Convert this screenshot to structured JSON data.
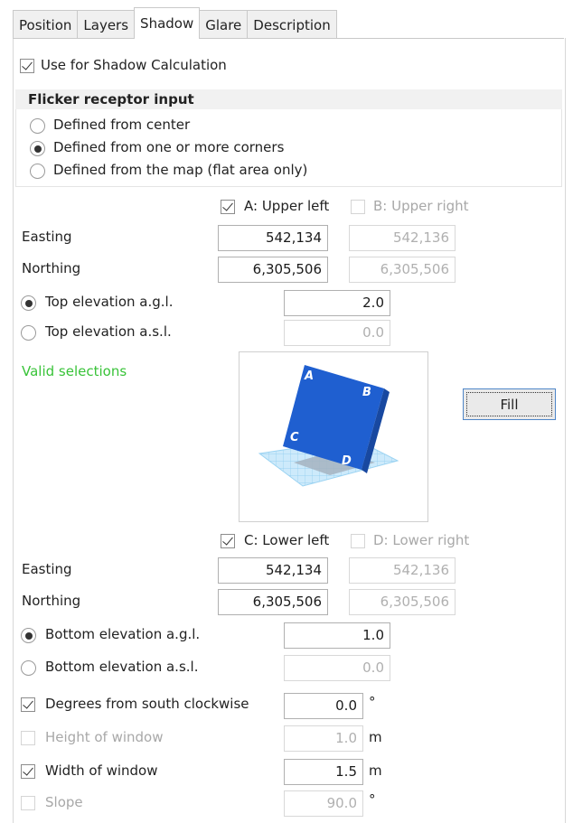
{
  "tabs": [
    "Position",
    "Layers",
    "Shadow",
    "Glare",
    "Description"
  ],
  "active_tab": "Shadow",
  "use_shadow": {
    "label": "Use for Shadow Calculation",
    "checked": true
  },
  "flicker": {
    "title": "Flicker receptor input",
    "options": [
      "Defined from center",
      "Defined from one or more corners",
      "Defined from the map (flat area only)"
    ],
    "selected": "Defined from one or more corners"
  },
  "upper": {
    "a_label": "A: Upper left",
    "a_checked": true,
    "b_label": "B: Upper right",
    "b_checked": false,
    "easting_label": "Easting",
    "northing_label": "Northing",
    "a_easting": "542,134",
    "b_easting": "542,136",
    "a_northing": "6,305,506",
    "b_northing": "6,305,506",
    "elev_agl_label": "Top elevation a.g.l.",
    "elev_agl": "2.0",
    "elev_asl_label": "Top elevation a.s.l.",
    "elev_asl": "0.0",
    "elev_selected": "agl"
  },
  "valid_text": "Valid selections",
  "preview": {
    "corner_a": "A",
    "corner_b": "B",
    "corner_c": "C",
    "corner_d": "D"
  },
  "fill_label": "Fill",
  "lower": {
    "c_label": "C: Lower left",
    "c_checked": true,
    "d_label": "D: Lower right",
    "d_checked": false,
    "easting_label": "Easting",
    "northing_label": "Northing",
    "c_easting": "542,134",
    "d_easting": "542,136",
    "c_northing": "6,305,506",
    "d_northing": "6,305,506",
    "elev_agl_label": "Bottom elevation a.g.l.",
    "elev_agl": "1.0",
    "elev_asl_label": "Bottom elevation a.s.l.",
    "elev_asl": "0.0",
    "elev_selected": "agl"
  },
  "orientation": {
    "degrees_label": "Degrees from south clockwise",
    "degrees_checked": true,
    "degrees": "0.0",
    "degrees_unit": "°",
    "height_label": "Height of window",
    "height_checked": false,
    "height": "1.0",
    "height_unit": "m",
    "width_label": "Width of window",
    "width_checked": true,
    "width": "1.5",
    "width_unit": "m",
    "slope_label": "Slope",
    "slope_checked": false,
    "slope": "90.0",
    "slope_unit": "°"
  },
  "colors": {
    "panel_blue": "#1f5fd0",
    "grid_blue": "#a9d9f5",
    "valid_green": "#39c339"
  }
}
